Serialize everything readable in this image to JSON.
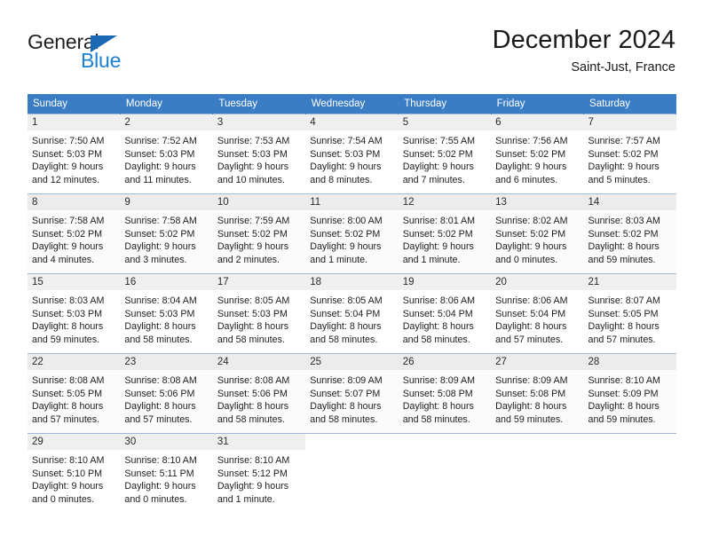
{
  "logo": {
    "primary_text": "General",
    "secondary_text": "Blue",
    "primary_color": "#231f20",
    "secondary_color": "#1b7fd4",
    "triangle_color": "#1b68b3"
  },
  "header": {
    "title": "December 2024",
    "subtitle": "Saint-Just, France"
  },
  "theme": {
    "header_row_bg": "#3b7dc4",
    "header_row_text": "#ffffff",
    "daynum_band_bg": "#efefef",
    "row_divider": "#9dbbd9"
  },
  "weekdays": [
    "Sunday",
    "Monday",
    "Tuesday",
    "Wednesday",
    "Thursday",
    "Friday",
    "Saturday"
  ],
  "weeks": [
    {
      "days": [
        {
          "day": "1",
          "sunrise": "Sunrise: 7:50 AM",
          "sunset": "Sunset: 5:03 PM",
          "daylight_line1": "Daylight: 9 hours",
          "daylight_line2": "and 12 minutes."
        },
        {
          "day": "2",
          "sunrise": "Sunrise: 7:52 AM",
          "sunset": "Sunset: 5:03 PM",
          "daylight_line1": "Daylight: 9 hours",
          "daylight_line2": "and 11 minutes."
        },
        {
          "day": "3",
          "sunrise": "Sunrise: 7:53 AM",
          "sunset": "Sunset: 5:03 PM",
          "daylight_line1": "Daylight: 9 hours",
          "daylight_line2": "and 10 minutes."
        },
        {
          "day": "4",
          "sunrise": "Sunrise: 7:54 AM",
          "sunset": "Sunset: 5:03 PM",
          "daylight_line1": "Daylight: 9 hours",
          "daylight_line2": "and 8 minutes."
        },
        {
          "day": "5",
          "sunrise": "Sunrise: 7:55 AM",
          "sunset": "Sunset: 5:02 PM",
          "daylight_line1": "Daylight: 9 hours",
          "daylight_line2": "and 7 minutes."
        },
        {
          "day": "6",
          "sunrise": "Sunrise: 7:56 AM",
          "sunset": "Sunset: 5:02 PM",
          "daylight_line1": "Daylight: 9 hours",
          "daylight_line2": "and 6 minutes."
        },
        {
          "day": "7",
          "sunrise": "Sunrise: 7:57 AM",
          "sunset": "Sunset: 5:02 PM",
          "daylight_line1": "Daylight: 9 hours",
          "daylight_line2": "and 5 minutes."
        }
      ]
    },
    {
      "days": [
        {
          "day": "8",
          "sunrise": "Sunrise: 7:58 AM",
          "sunset": "Sunset: 5:02 PM",
          "daylight_line1": "Daylight: 9 hours",
          "daylight_line2": "and 4 minutes."
        },
        {
          "day": "9",
          "sunrise": "Sunrise: 7:58 AM",
          "sunset": "Sunset: 5:02 PM",
          "daylight_line1": "Daylight: 9 hours",
          "daylight_line2": "and 3 minutes."
        },
        {
          "day": "10",
          "sunrise": "Sunrise: 7:59 AM",
          "sunset": "Sunset: 5:02 PM",
          "daylight_line1": "Daylight: 9 hours",
          "daylight_line2": "and 2 minutes."
        },
        {
          "day": "11",
          "sunrise": "Sunrise: 8:00 AM",
          "sunset": "Sunset: 5:02 PM",
          "daylight_line1": "Daylight: 9 hours",
          "daylight_line2": "and 1 minute."
        },
        {
          "day": "12",
          "sunrise": "Sunrise: 8:01 AM",
          "sunset": "Sunset: 5:02 PM",
          "daylight_line1": "Daylight: 9 hours",
          "daylight_line2": "and 1 minute."
        },
        {
          "day": "13",
          "sunrise": "Sunrise: 8:02 AM",
          "sunset": "Sunset: 5:02 PM",
          "daylight_line1": "Daylight: 9 hours",
          "daylight_line2": "and 0 minutes."
        },
        {
          "day": "14",
          "sunrise": "Sunrise: 8:03 AM",
          "sunset": "Sunset: 5:02 PM",
          "daylight_line1": "Daylight: 8 hours",
          "daylight_line2": "and 59 minutes."
        }
      ]
    },
    {
      "days": [
        {
          "day": "15",
          "sunrise": "Sunrise: 8:03 AM",
          "sunset": "Sunset: 5:03 PM",
          "daylight_line1": "Daylight: 8 hours",
          "daylight_line2": "and 59 minutes."
        },
        {
          "day": "16",
          "sunrise": "Sunrise: 8:04 AM",
          "sunset": "Sunset: 5:03 PM",
          "daylight_line1": "Daylight: 8 hours",
          "daylight_line2": "and 58 minutes."
        },
        {
          "day": "17",
          "sunrise": "Sunrise: 8:05 AM",
          "sunset": "Sunset: 5:03 PM",
          "daylight_line1": "Daylight: 8 hours",
          "daylight_line2": "and 58 minutes."
        },
        {
          "day": "18",
          "sunrise": "Sunrise: 8:05 AM",
          "sunset": "Sunset: 5:04 PM",
          "daylight_line1": "Daylight: 8 hours",
          "daylight_line2": "and 58 minutes."
        },
        {
          "day": "19",
          "sunrise": "Sunrise: 8:06 AM",
          "sunset": "Sunset: 5:04 PM",
          "daylight_line1": "Daylight: 8 hours",
          "daylight_line2": "and 58 minutes."
        },
        {
          "day": "20",
          "sunrise": "Sunrise: 8:06 AM",
          "sunset": "Sunset: 5:04 PM",
          "daylight_line1": "Daylight: 8 hours",
          "daylight_line2": "and 57 minutes."
        },
        {
          "day": "21",
          "sunrise": "Sunrise: 8:07 AM",
          "sunset": "Sunset: 5:05 PM",
          "daylight_line1": "Daylight: 8 hours",
          "daylight_line2": "and 57 minutes."
        }
      ]
    },
    {
      "days": [
        {
          "day": "22",
          "sunrise": "Sunrise: 8:08 AM",
          "sunset": "Sunset: 5:05 PM",
          "daylight_line1": "Daylight: 8 hours",
          "daylight_line2": "and 57 minutes."
        },
        {
          "day": "23",
          "sunrise": "Sunrise: 8:08 AM",
          "sunset": "Sunset: 5:06 PM",
          "daylight_line1": "Daylight: 8 hours",
          "daylight_line2": "and 57 minutes."
        },
        {
          "day": "24",
          "sunrise": "Sunrise: 8:08 AM",
          "sunset": "Sunset: 5:06 PM",
          "daylight_line1": "Daylight: 8 hours",
          "daylight_line2": "and 58 minutes."
        },
        {
          "day": "25",
          "sunrise": "Sunrise: 8:09 AM",
          "sunset": "Sunset: 5:07 PM",
          "daylight_line1": "Daylight: 8 hours",
          "daylight_line2": "and 58 minutes."
        },
        {
          "day": "26",
          "sunrise": "Sunrise: 8:09 AM",
          "sunset": "Sunset: 5:08 PM",
          "daylight_line1": "Daylight: 8 hours",
          "daylight_line2": "and 58 minutes."
        },
        {
          "day": "27",
          "sunrise": "Sunrise: 8:09 AM",
          "sunset": "Sunset: 5:08 PM",
          "daylight_line1": "Daylight: 8 hours",
          "daylight_line2": "and 59 minutes."
        },
        {
          "day": "28",
          "sunrise": "Sunrise: 8:10 AM",
          "sunset": "Sunset: 5:09 PM",
          "daylight_line1": "Daylight: 8 hours",
          "daylight_line2": "and 59 minutes."
        }
      ]
    },
    {
      "days": [
        {
          "day": "29",
          "sunrise": "Sunrise: 8:10 AM",
          "sunset": "Sunset: 5:10 PM",
          "daylight_line1": "Daylight: 9 hours",
          "daylight_line2": "and 0 minutes."
        },
        {
          "day": "30",
          "sunrise": "Sunrise: 8:10 AM",
          "sunset": "Sunset: 5:11 PM",
          "daylight_line1": "Daylight: 9 hours",
          "daylight_line2": "and 0 minutes."
        },
        {
          "day": "31",
          "sunrise": "Sunrise: 8:10 AM",
          "sunset": "Sunset: 5:12 PM",
          "daylight_line1": "Daylight: 9 hours",
          "daylight_line2": "and 1 minute."
        },
        {
          "day": "",
          "sunrise": "",
          "sunset": "",
          "daylight_line1": "",
          "daylight_line2": ""
        },
        {
          "day": "",
          "sunrise": "",
          "sunset": "",
          "daylight_line1": "",
          "daylight_line2": ""
        },
        {
          "day": "",
          "sunrise": "",
          "sunset": "",
          "daylight_line1": "",
          "daylight_line2": ""
        },
        {
          "day": "",
          "sunrise": "",
          "sunset": "",
          "daylight_line1": "",
          "daylight_line2": ""
        }
      ]
    }
  ]
}
